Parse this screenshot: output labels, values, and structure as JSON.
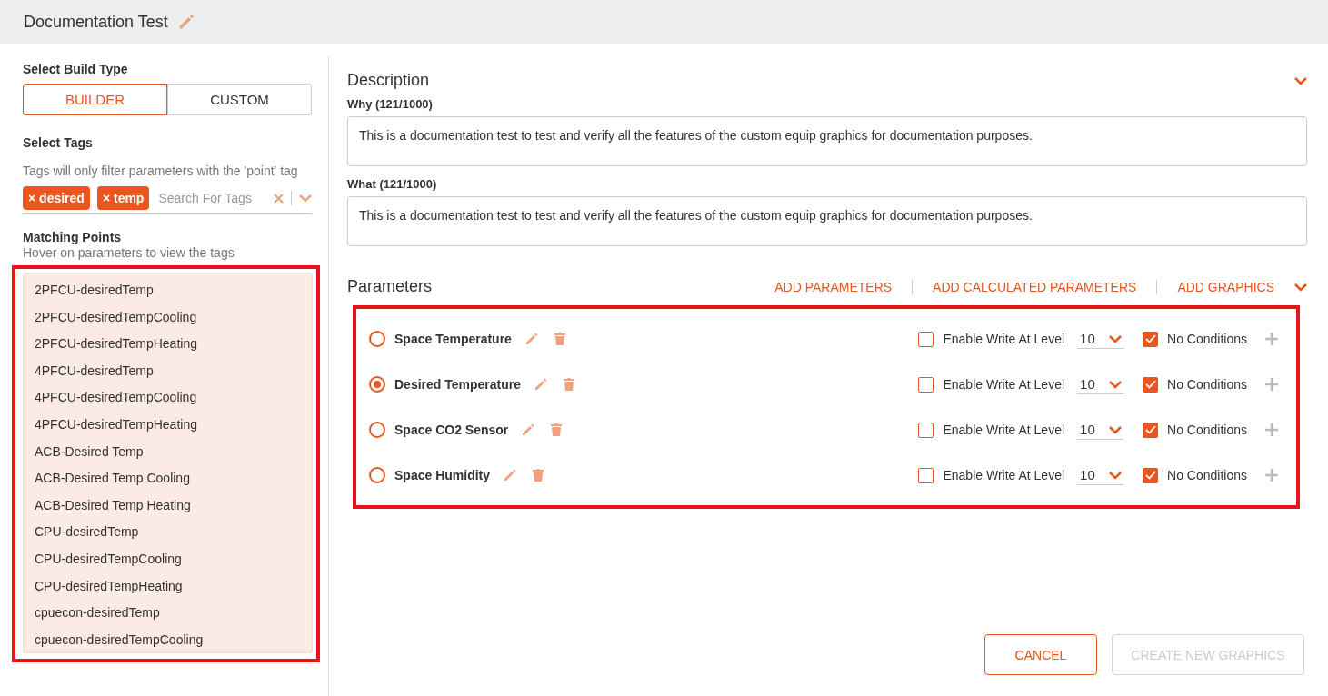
{
  "header": {
    "title": "Documentation Test"
  },
  "build_type": {
    "label": "Select Build Type",
    "options": [
      {
        "label": "BUILDER",
        "selected": true
      },
      {
        "label": "CUSTOM",
        "selected": false
      }
    ]
  },
  "tags": {
    "label": "Select Tags",
    "hint": "Tags will only filter parameters with the 'point' tag",
    "chips": [
      {
        "label": "desired",
        "remove": "×"
      },
      {
        "label": "temp",
        "remove": "×"
      }
    ],
    "placeholder": "Search For Tags"
  },
  "matching_points": {
    "label": "Matching Points",
    "hint": "Hover on parameters to view the tags",
    "highlighted": true,
    "items": [
      "2PFCU-desiredTemp",
      "2PFCU-desiredTempCooling",
      "2PFCU-desiredTempHeating",
      "4PFCU-desiredTemp",
      "4PFCU-desiredTempCooling",
      "4PFCU-desiredTempHeating",
      "ACB-Desired Temp",
      "ACB-Desired Temp Cooling",
      "ACB-Desired Temp Heating",
      "CPU-desiredTemp",
      "CPU-desiredTempCooling",
      "CPU-desiredTempHeating",
      "cpuecon-desiredTemp",
      "cpuecon-desiredTempCooling"
    ]
  },
  "description": {
    "title": "Description",
    "fields": [
      {
        "label": "Why (121/1000)",
        "value": "This is a documentation test to test and verify all the features of the custom equip graphics for documentation purposes."
      },
      {
        "label": "What (121/1000)",
        "value": "This is a documentation test to test and verify all the features of the custom equip graphics for documentation purposes."
      }
    ]
  },
  "parameters": {
    "title": "Parameters",
    "actions": [
      "ADD PARAMETERS",
      "ADD CALCULATED PARAMETERS",
      "ADD GRAPHICS"
    ],
    "highlighted": true,
    "rows": [
      {
        "name": "Space Temperature",
        "selected": false,
        "write_label": "Enable Write At Level",
        "write_enabled": false,
        "level_value": "10",
        "conditions_label": "No Conditions",
        "no_conditions": true
      },
      {
        "name": "Desired Temperature",
        "selected": true,
        "write_label": "Enable Write At Level",
        "write_enabled": false,
        "level_value": "10",
        "conditions_label": "No Conditions",
        "no_conditions": true
      },
      {
        "name": "Space CO2 Sensor",
        "selected": false,
        "write_label": "Enable Write At Level",
        "write_enabled": false,
        "level_value": "10",
        "conditions_label": "No Conditions",
        "no_conditions": true
      },
      {
        "name": "Space Humidity",
        "selected": false,
        "write_label": "Enable Write At Level",
        "write_enabled": false,
        "level_value": "10",
        "conditions_label": "No Conditions",
        "no_conditions": true
      }
    ]
  },
  "footer": {
    "buttons": [
      {
        "label": "CANCEL",
        "disabled": false
      },
      {
        "label": "CREATE NEW GRAPHICS",
        "disabled": true
      }
    ]
  }
}
